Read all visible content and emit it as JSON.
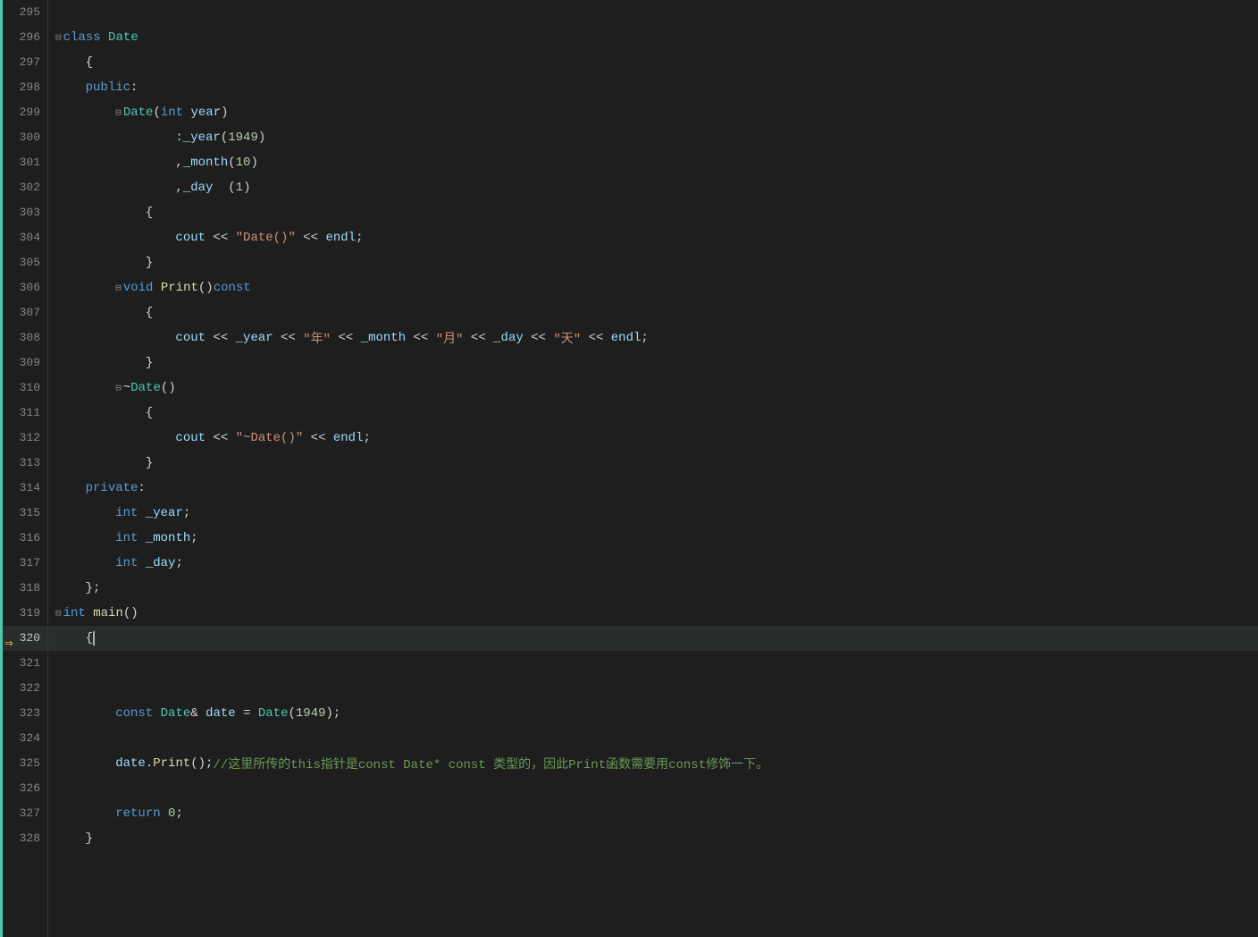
{
  "editor": {
    "title": "class Date",
    "lines": [
      {
        "num": 295,
        "content": [],
        "indent": 0,
        "collapse": false
      },
      {
        "num": 296,
        "content": [
          {
            "t": "collapse",
            "text": "⊟"
          },
          {
            "t": "kw",
            "text": "class"
          },
          {
            "t": "plain",
            "text": " "
          },
          {
            "t": "typename",
            "text": "Date"
          }
        ],
        "indent": 0,
        "collapse": true
      },
      {
        "num": 297,
        "content": [
          {
            "t": "plain",
            "text": "{"
          }
        ],
        "indent": 1
      },
      {
        "num": 298,
        "content": [
          {
            "t": "kw",
            "text": "public"
          },
          {
            "t": "plain",
            "text": ":"
          }
        ],
        "indent": 1
      },
      {
        "num": 299,
        "content": [
          {
            "t": "collapse",
            "text": "⊟"
          },
          {
            "t": "typename",
            "text": "Date"
          },
          {
            "t": "plain",
            "text": "("
          },
          {
            "t": "kw",
            "text": "int"
          },
          {
            "t": "plain",
            "text": " "
          },
          {
            "t": "var",
            "text": "year"
          },
          {
            "t": "plain",
            "text": ")"
          }
        ],
        "indent": 2,
        "collapse": true
      },
      {
        "num": 300,
        "content": [
          {
            "t": "plain",
            "text": ":"
          },
          {
            "t": "var",
            "text": "_year"
          },
          {
            "t": "plain",
            "text": "("
          },
          {
            "t": "num",
            "text": "1949"
          },
          {
            "t": "plain",
            "text": ")"
          }
        ],
        "indent": 4
      },
      {
        "num": 301,
        "content": [
          {
            "t": "plain",
            "text": ","
          },
          {
            "t": "var",
            "text": "_month"
          },
          {
            "t": "plain",
            "text": "("
          },
          {
            "t": "num",
            "text": "10"
          },
          {
            "t": "plain",
            "text": ")"
          }
        ],
        "indent": 4
      },
      {
        "num": 302,
        "content": [
          {
            "t": "plain",
            "text": ","
          },
          {
            "t": "var",
            "text": "_day"
          },
          {
            "t": "plain",
            "text": "  ("
          },
          {
            "t": "num",
            "text": "1"
          },
          {
            "t": "plain",
            "text": ")"
          }
        ],
        "indent": 4
      },
      {
        "num": 303,
        "content": [
          {
            "t": "plain",
            "text": "{"
          }
        ],
        "indent": 3
      },
      {
        "num": 304,
        "content": [
          {
            "t": "var",
            "text": "cout"
          },
          {
            "t": "plain",
            "text": " << "
          },
          {
            "t": "str",
            "text": "\"Date()\""
          },
          {
            "t": "plain",
            "text": " << "
          },
          {
            "t": "var",
            "text": "endl"
          },
          {
            "t": "plain",
            "text": ";"
          }
        ],
        "indent": 4
      },
      {
        "num": 305,
        "content": [
          {
            "t": "plain",
            "text": "}"
          }
        ],
        "indent": 3
      },
      {
        "num": 306,
        "content": [
          {
            "t": "collapse",
            "text": "⊟"
          },
          {
            "t": "kw",
            "text": "void"
          },
          {
            "t": "plain",
            "text": " "
          },
          {
            "t": "fn",
            "text": "Print"
          },
          {
            "t": "plain",
            "text": "()"
          },
          {
            "t": "kw",
            "text": "const"
          }
        ],
        "indent": 2,
        "collapse": true
      },
      {
        "num": 307,
        "content": [
          {
            "t": "plain",
            "text": "{"
          }
        ],
        "indent": 3
      },
      {
        "num": 308,
        "content": [
          {
            "t": "var",
            "text": "cout"
          },
          {
            "t": "plain",
            "text": " << "
          },
          {
            "t": "var",
            "text": "_year"
          },
          {
            "t": "plain",
            "text": " << "
          },
          {
            "t": "str",
            "text": "\"年\""
          },
          {
            "t": "plain",
            "text": " << "
          },
          {
            "t": "var",
            "text": "_month"
          },
          {
            "t": "plain",
            "text": " << "
          },
          {
            "t": "str",
            "text": "\"月\""
          },
          {
            "t": "plain",
            "text": " << "
          },
          {
            "t": "var",
            "text": "_day"
          },
          {
            "t": "plain",
            "text": " << "
          },
          {
            "t": "str",
            "text": "\"天\""
          },
          {
            "t": "plain",
            "text": " << "
          },
          {
            "t": "var",
            "text": "endl"
          },
          {
            "t": "plain",
            "text": ";"
          }
        ],
        "indent": 4
      },
      {
        "num": 309,
        "content": [
          {
            "t": "plain",
            "text": "}"
          }
        ],
        "indent": 3
      },
      {
        "num": 310,
        "content": [
          {
            "t": "collapse",
            "text": "⊟"
          },
          {
            "t": "plain",
            "text": "~"
          },
          {
            "t": "typename",
            "text": "Date"
          },
          {
            "t": "plain",
            "text": "()"
          }
        ],
        "indent": 2,
        "collapse": true
      },
      {
        "num": 311,
        "content": [
          {
            "t": "plain",
            "text": "{"
          }
        ],
        "indent": 3
      },
      {
        "num": 312,
        "content": [
          {
            "t": "var",
            "text": "cout"
          },
          {
            "t": "plain",
            "text": " << "
          },
          {
            "t": "str",
            "text": "\"~Date()\""
          },
          {
            "t": "plain",
            "text": " << "
          },
          {
            "t": "var",
            "text": "endl"
          },
          {
            "t": "plain",
            "text": ";"
          }
        ],
        "indent": 4
      },
      {
        "num": 313,
        "content": [
          {
            "t": "plain",
            "text": "}"
          }
        ],
        "indent": 3
      },
      {
        "num": 314,
        "content": [
          {
            "t": "kw",
            "text": "private"
          },
          {
            "t": "plain",
            "text": ":"
          }
        ],
        "indent": 1
      },
      {
        "num": 315,
        "content": [
          {
            "t": "kw",
            "text": "int"
          },
          {
            "t": "plain",
            "text": " "
          },
          {
            "t": "var",
            "text": "_year"
          },
          {
            "t": "plain",
            "text": ";"
          }
        ],
        "indent": 2
      },
      {
        "num": 316,
        "content": [
          {
            "t": "kw",
            "text": "int"
          },
          {
            "t": "plain",
            "text": " "
          },
          {
            "t": "var",
            "text": "_month"
          },
          {
            "t": "plain",
            "text": ";"
          }
        ],
        "indent": 2
      },
      {
        "num": 317,
        "content": [
          {
            "t": "kw",
            "text": "int"
          },
          {
            "t": "plain",
            "text": " "
          },
          {
            "t": "var",
            "text": "_day"
          },
          {
            "t": "plain",
            "text": ";"
          }
        ],
        "indent": 2
      },
      {
        "num": 318,
        "content": [
          {
            "t": "plain",
            "text": "};"
          }
        ],
        "indent": 1
      },
      {
        "num": 319,
        "content": [
          {
            "t": "collapse",
            "text": "⊟"
          },
          {
            "t": "kw",
            "text": "int"
          },
          {
            "t": "plain",
            "text": " "
          },
          {
            "t": "fn",
            "text": "main"
          },
          {
            "t": "plain",
            "text": "()"
          }
        ],
        "indent": 0,
        "collapse": true
      },
      {
        "num": 320,
        "content": [
          {
            "t": "plain",
            "text": "{"
          },
          {
            "t": "cursor",
            "text": ""
          }
        ],
        "indent": 1,
        "current": true
      },
      {
        "num": 321,
        "content": [],
        "indent": 0
      },
      {
        "num": 322,
        "content": [],
        "indent": 0
      },
      {
        "num": 323,
        "content": [
          {
            "t": "kw",
            "text": "const"
          },
          {
            "t": "plain",
            "text": " "
          },
          {
            "t": "typename",
            "text": "Date"
          },
          {
            "t": "plain",
            "text": "& "
          },
          {
            "t": "var",
            "text": "date"
          },
          {
            "t": "plain",
            "text": " = "
          },
          {
            "t": "typename",
            "text": "Date"
          },
          {
            "t": "plain",
            "text": "("
          },
          {
            "t": "num",
            "text": "1949"
          },
          {
            "t": "plain",
            "text": ");"
          }
        ],
        "indent": 2
      },
      {
        "num": 324,
        "content": [],
        "indent": 0
      },
      {
        "num": 325,
        "content": [
          {
            "t": "var",
            "text": "date"
          },
          {
            "t": "plain",
            "text": "."
          },
          {
            "t": "fn",
            "text": "Print"
          },
          {
            "t": "plain",
            "text": "();"
          },
          {
            "t": "comment",
            "text": "//这里所传的this指针是const Date* const 类型的，因此Print函数需要用const修饰一下。"
          }
        ],
        "indent": 2
      },
      {
        "num": 326,
        "content": [],
        "indent": 0
      },
      {
        "num": 327,
        "content": [
          {
            "t": "kw",
            "text": "return"
          },
          {
            "t": "plain",
            "text": " "
          },
          {
            "t": "num",
            "text": "0"
          },
          {
            "t": "plain",
            "text": ";"
          }
        ],
        "indent": 2
      },
      {
        "num": 328,
        "content": [
          {
            "t": "plain",
            "text": "}"
          }
        ],
        "indent": 1
      }
    ]
  }
}
